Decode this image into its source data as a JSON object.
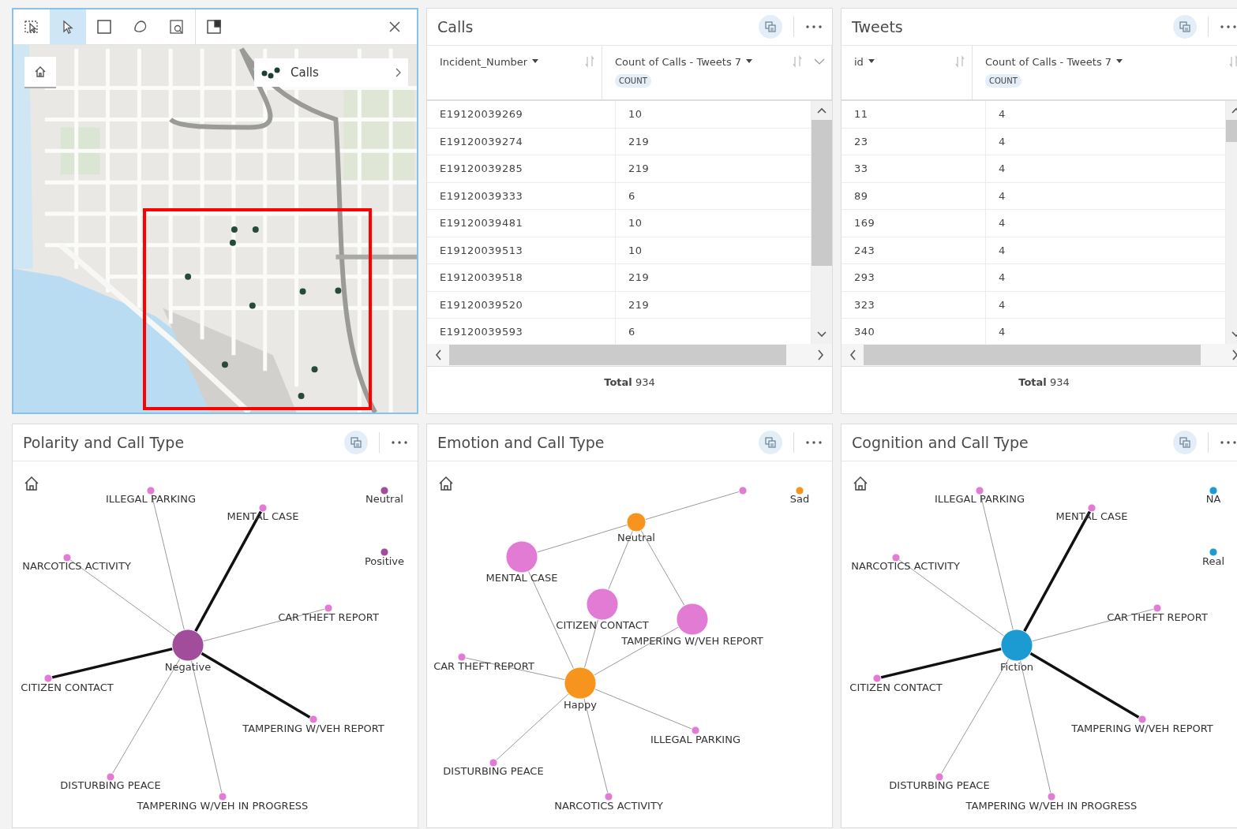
{
  "map": {
    "tools": [
      {
        "kind": "select-frame",
        "selected": false
      },
      {
        "kind": "pointer",
        "selected": true
      },
      {
        "kind": "rectangle",
        "selected": false
      },
      {
        "kind": "lasso",
        "selected": false
      },
      {
        "kind": "zoom-select",
        "selected": false
      },
      {
        "kind": "panel-toggle",
        "selected": false
      }
    ],
    "legend": {
      "label": "Calls"
    }
  },
  "tables": [
    {
      "title": "Calls",
      "columns": [
        {
          "label": "Incident_Number"
        },
        {
          "label": "Count of Calls - Tweets 7",
          "badge": "COUNT"
        }
      ],
      "rows": [
        [
          "E19120039269",
          "10"
        ],
        [
          "E19120039274",
          "219"
        ],
        [
          "E19120039285",
          "219"
        ],
        [
          "E19120039333",
          "6"
        ],
        [
          "E19120039481",
          "10"
        ],
        [
          "E19120039513",
          "10"
        ],
        [
          "E19120039518",
          "219"
        ],
        [
          "E19120039520",
          "219"
        ],
        [
          "E19120039593",
          "6"
        ]
      ],
      "footer": "**Total** 934"
    },
    {
      "title": "Tweets",
      "columns": [
        {
          "label": "id"
        },
        {
          "label": "Count of Calls - Tweets 7",
          "badge": "COUNT"
        }
      ],
      "rows": [
        [
          "11",
          "4"
        ],
        [
          "23",
          "4"
        ],
        [
          "33",
          "4"
        ],
        [
          "89",
          "4"
        ],
        [
          "169",
          "4"
        ],
        [
          "243",
          "4"
        ],
        [
          "293",
          "4"
        ],
        [
          "323",
          "4"
        ],
        [
          "340",
          "4"
        ]
      ],
      "footer": "**Total** 934"
    }
  ],
  "graphs": [
    {
      "title": "Polarity and Call Type",
      "nodes": [
        {
          "label": "Negative",
          "color": "#a14d9c",
          "kind": "large"
        },
        {
          "label": "ILLEGAL PARKING",
          "color": "#e27bd3",
          "kind": "small"
        },
        {
          "label": "MENTAL CASE",
          "color": "#e27bd3",
          "kind": "small"
        },
        {
          "label": "NARCOTICS ACTIVITY",
          "color": "#e27bd3",
          "kind": "small"
        },
        {
          "label": "CAR THEFT REPORT",
          "color": "#e27bd3",
          "kind": "small"
        },
        {
          "label": "CITIZEN CONTACT",
          "color": "#e27bd3",
          "kind": "small"
        },
        {
          "label": "TAMPERING W/VEH REPORT",
          "color": "#e27bd3",
          "kind": "small"
        },
        {
          "label": "DISTURBING PEACE",
          "color": "#e27bd3",
          "kind": "small"
        },
        {
          "label": "TAMPERING W/VEH IN PROGRESS",
          "color": "#e27bd3",
          "kind": "small"
        },
        {
          "label": "Neutral",
          "color": "#a14d9c",
          "kind": "small"
        },
        {
          "label": "Positive",
          "color": "#a14d9c",
          "kind": "small"
        }
      ],
      "edges": [
        {
          "strong": false
        },
        {
          "strong": true
        },
        {
          "strong": false
        },
        {
          "strong": false
        },
        {
          "strong": true
        },
        {
          "strong": true
        },
        {
          "strong": false
        },
        {
          "strong": false
        }
      ]
    },
    {
      "title": "Emotion and Call Type",
      "nodes": [
        {
          "label": "Neutral",
          "color": "#f7941d",
          "kind": "medium"
        },
        {
          "label": "Happy",
          "color": "#f7941d",
          "kind": "large"
        },
        {
          "label": "Sad",
          "color": "#f7941d",
          "kind": "small"
        },
        {
          "color": "#e27bd3",
          "kind": "small"
        },
        {
          "label": "MENTAL CASE",
          "color": "#e27bd3",
          "kind": "large"
        },
        {
          "label": "CITIZEN CONTACT",
          "color": "#e27bd3",
          "kind": "large"
        },
        {
          "label": "TAMPERING W/VEH REPORT",
          "color": "#e27bd3",
          "kind": "large"
        },
        {
          "label": "CAR THEFT REPORT",
          "color": "#e27bd3",
          "kind": "small"
        },
        {
          "label": "ILLEGAL PARKING",
          "color": "#e27bd3",
          "kind": "small"
        },
        {
          "label": "DISTURBING PEACE",
          "color": "#e27bd3",
          "kind": "small"
        },
        {
          "label": "NARCOTICS ACTIVITY",
          "color": "#e27bd3",
          "kind": "small"
        }
      ],
      "edges": [
        {
          "strong": false
        },
        {
          "strong": false
        },
        {
          "strong": false
        },
        {
          "strong": false
        },
        {
          "strong": false
        },
        {
          "strong": false
        },
        {
          "strong": false
        },
        {
          "strong": false
        },
        {
          "strong": false
        },
        {
          "strong": false
        },
        {
          "strong": false
        }
      ]
    },
    {
      "title": "Cognition and Call Type",
      "nodes": [
        {
          "label": "Fiction",
          "color": "#1b9bd1",
          "kind": "large"
        },
        {
          "label": "ILLEGAL PARKING",
          "color": "#e27bd3",
          "kind": "small"
        },
        {
          "label": "MENTAL CASE",
          "color": "#e27bd3",
          "kind": "small"
        },
        {
          "label": "NARCOTICS ACTIVITY",
          "color": "#e27bd3",
          "kind": "small"
        },
        {
          "label": "CAR THEFT REPORT",
          "color": "#e27bd3",
          "kind": "small"
        },
        {
          "label": "CITIZEN CONTACT",
          "color": "#e27bd3",
          "kind": "small"
        },
        {
          "label": "TAMPERING W/VEH REPORT",
          "color": "#e27bd3",
          "kind": "small"
        },
        {
          "label": "DISTURBING PEACE",
          "color": "#e27bd3",
          "kind": "small"
        },
        {
          "label": "TAMPERING W/VEH IN PROGRESS",
          "color": "#e27bd3",
          "kind": "small"
        },
        {
          "label": "NA",
          "color": "#1b9bd1",
          "kind": "small"
        },
        {
          "label": "Real",
          "color": "#1b9bd1",
          "kind": "small"
        }
      ],
      "edges": [
        {
          "strong": false
        },
        {
          "strong": true
        },
        {
          "strong": false
        },
        {
          "strong": false
        },
        {
          "strong": true
        },
        {
          "strong": true
        },
        {
          "strong": false
        },
        {
          "strong": false
        }
      ]
    }
  ]
}
